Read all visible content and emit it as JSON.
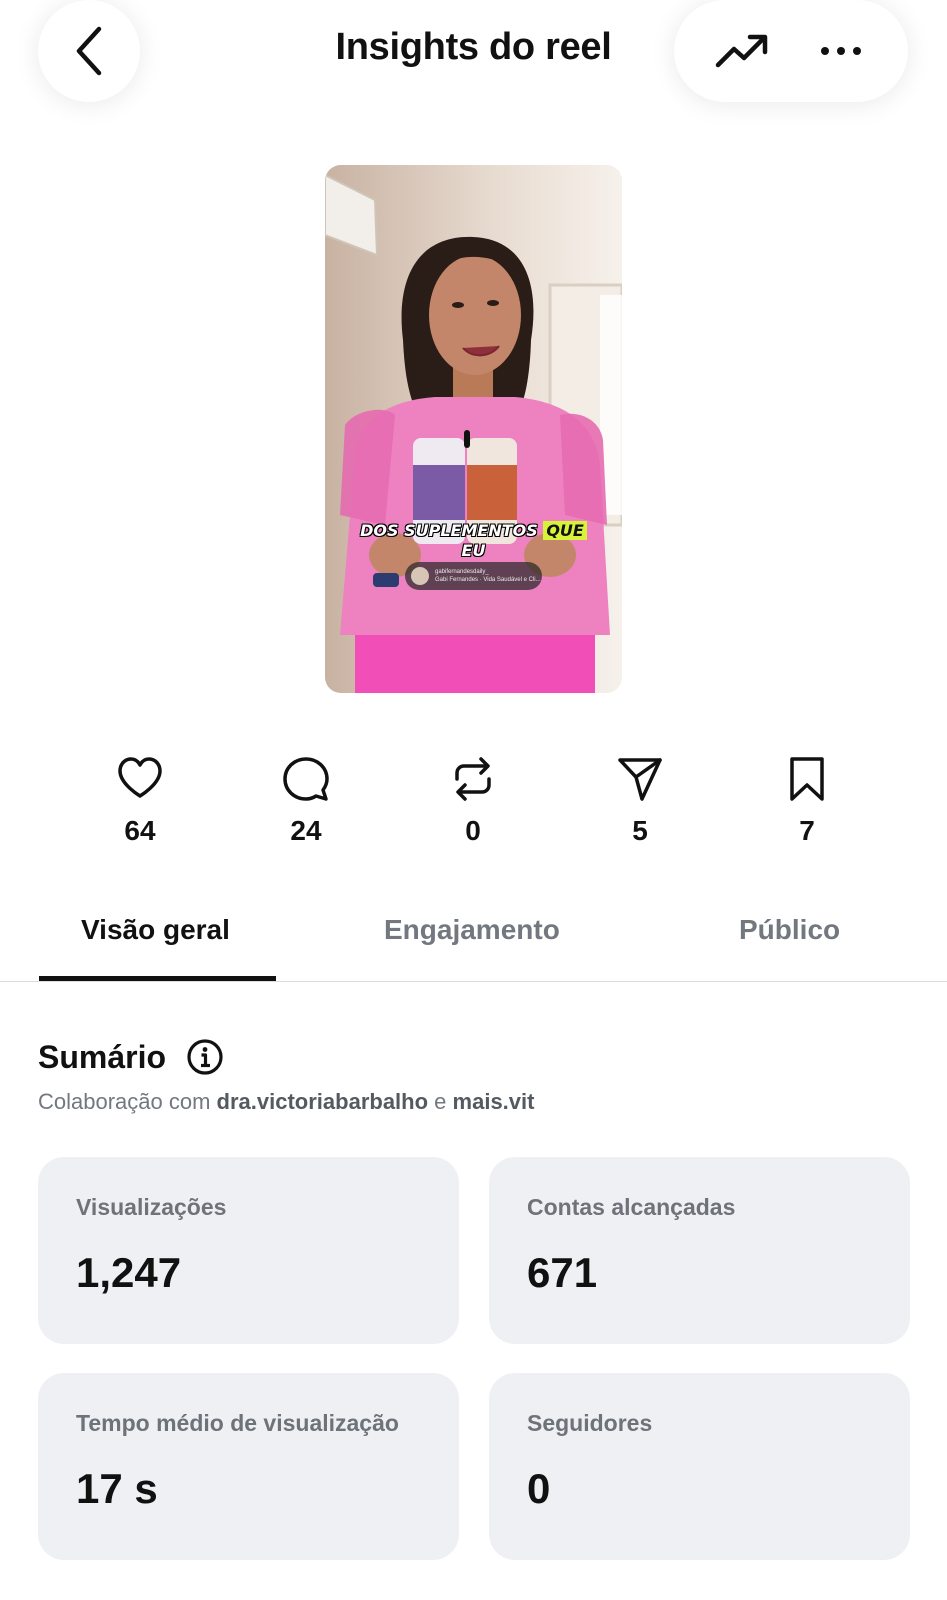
{
  "header": {
    "title": "Insights do reel",
    "back_icon": "chevron-left-icon",
    "trend_icon": "trending-up-icon",
    "more_icon": "more-horizontal-icon"
  },
  "reel": {
    "caption_part1": "DOS SUPLEMENTOS ",
    "caption_highlight": "QUE",
    "caption_line2": "EU",
    "collab_chip_line1": "gabifernandesdaily_",
    "collab_chip_line2": "Gabi Fernandes · Vida Saudável e Cli..."
  },
  "stats": [
    {
      "icon": "heart-icon",
      "value": "64"
    },
    {
      "icon": "comment-icon",
      "value": "24"
    },
    {
      "icon": "repost-icon",
      "value": "0"
    },
    {
      "icon": "send-icon",
      "value": "5"
    },
    {
      "icon": "bookmark-icon",
      "value": "7"
    }
  ],
  "tabs": [
    {
      "label": "Visão geral",
      "active": true
    },
    {
      "label": "Engajamento",
      "active": false
    },
    {
      "label": "Público",
      "active": false
    }
  ],
  "summary": {
    "title": "Sumário",
    "collab_prefix": "Colaboração com ",
    "collab_user1": "dra.victoriabarbalho",
    "collab_sep": " e ",
    "collab_user2": "mais.vit"
  },
  "cards": [
    {
      "label": "Visualizações",
      "value": "1,247"
    },
    {
      "label": "Contas alcançadas",
      "value": "671"
    },
    {
      "label": "Tempo médio de visualização",
      "value": "17 s"
    },
    {
      "label": "Seguidores",
      "value": "0"
    }
  ],
  "colors": {
    "text": "#111111",
    "muted": "#737880",
    "card_bg": "#eff0f4",
    "caption_highlight": "#d8f23a"
  }
}
